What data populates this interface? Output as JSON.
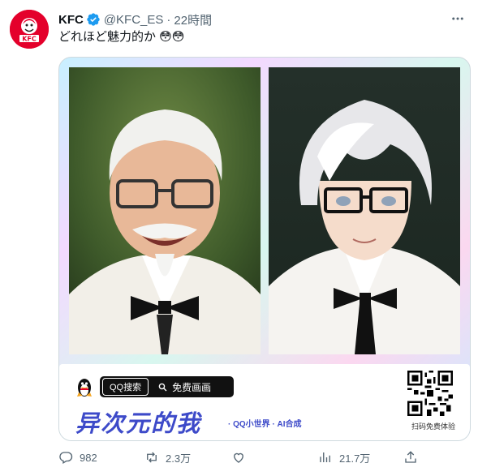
{
  "tweet": {
    "author_name": "KFC",
    "handle": "@KFC_ES",
    "separator": "·",
    "time": "22時間",
    "text": "どれほど魅力的か 😳😳",
    "more_icon": "more-horizontal-icon",
    "verified_color": "#1d9bf0",
    "avatar_color": "#e4002b",
    "avatar_text": "KFC"
  },
  "media": {
    "search_tag": "QQ搜索",
    "search_text": "免费画画",
    "big_title": "异次元的我",
    "subtitle": "· QQ小世界 · AI合成",
    "qr_caption": "扫码免费体验",
    "title_color": "#3d4ac9"
  },
  "actions": {
    "reply_count": "982",
    "retweet_count": "2.3万",
    "like_count": "",
    "views_count": "21.7万",
    "icons": [
      "reply-icon",
      "retweet-icon",
      "like-icon",
      "views-icon",
      "share-icon"
    ]
  }
}
